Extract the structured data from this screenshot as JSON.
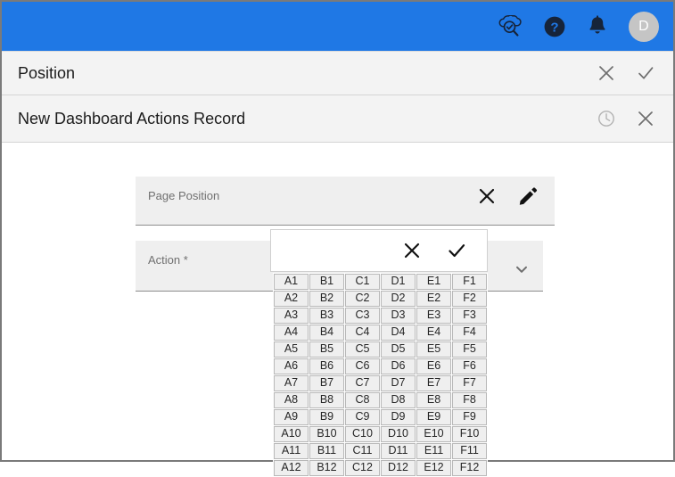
{
  "banner": {
    "background_color": "#1f78e5",
    "icons": [
      {
        "name": "cloud-search-icon",
        "title": "Search"
      },
      {
        "name": "help-icon",
        "title": "Help"
      },
      {
        "name": "bell-icon",
        "title": "Notifications"
      }
    ],
    "avatar": {
      "initial": "D",
      "background_color": "#c5c5c5"
    }
  },
  "header_strips": [
    {
      "title": "Position",
      "actions": [
        {
          "name": "close-icon",
          "label": "Close"
        },
        {
          "name": "check-icon",
          "label": "Confirm"
        }
      ]
    },
    {
      "title": "New Dashboard Actions Record",
      "actions": [
        {
          "name": "history-clock-icon",
          "label": "History"
        },
        {
          "name": "close-icon",
          "label": "Close"
        }
      ]
    }
  ],
  "form": {
    "fields": [
      {
        "label": "Page Position",
        "value": "",
        "required": false,
        "icons": [
          {
            "name": "clear-icon",
            "label": "Clear"
          },
          {
            "name": "edit-pencil-icon",
            "label": "Edit"
          }
        ]
      },
      {
        "label": "Action *",
        "value": "",
        "required": true,
        "icons": [
          {
            "name": "chevron-down-icon",
            "label": "Open dropdown"
          }
        ]
      }
    ]
  },
  "picker": {
    "actions": [
      {
        "name": "cancel-icon",
        "label": "Cancel"
      },
      {
        "name": "confirm-check-icon",
        "label": "Confirm"
      }
    ],
    "columns": [
      "A",
      "B",
      "C",
      "D",
      "E",
      "F"
    ],
    "rows": [
      [
        "A1",
        "B1",
        "C1",
        "D1",
        "E1",
        "F1"
      ],
      [
        "A2",
        "B2",
        "C2",
        "D2",
        "E2",
        "F2"
      ],
      [
        "A3",
        "B3",
        "C3",
        "D3",
        "E3",
        "F3"
      ],
      [
        "A4",
        "B4",
        "C4",
        "D4",
        "E4",
        "F4"
      ],
      [
        "A5",
        "B5",
        "C5",
        "D5",
        "E5",
        "F5"
      ],
      [
        "A6",
        "B6",
        "C6",
        "D6",
        "E6",
        "F6"
      ],
      [
        "A7",
        "B7",
        "C7",
        "D7",
        "E7",
        "F7"
      ],
      [
        "A8",
        "B8",
        "C8",
        "D8",
        "E8",
        "F8"
      ],
      [
        "A9",
        "B9",
        "C9",
        "D9",
        "E9",
        "F9"
      ],
      [
        "A10",
        "B10",
        "C10",
        "D10",
        "E10",
        "F10"
      ],
      [
        "A11",
        "B11",
        "C11",
        "D11",
        "E11",
        "F11"
      ],
      [
        "A12",
        "B12",
        "C12",
        "D12",
        "E12",
        "F12"
      ]
    ]
  }
}
